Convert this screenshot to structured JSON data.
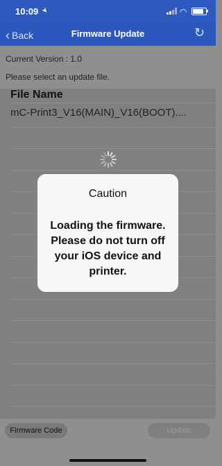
{
  "status_bar": {
    "time": "10:09"
  },
  "nav": {
    "back_label": "Back",
    "title": "Firmware Update"
  },
  "info": {
    "current_version": "Current Version : 1.0",
    "instruction": "Please select an update file."
  },
  "list": {
    "header": "File Name",
    "rows": [
      "mC-Print3_V16(MAIN)_V16(BOOT)...."
    ]
  },
  "dialog": {
    "title": "Caution",
    "message": "Loading the firmware. Please do not turn off your iOS device and printer."
  },
  "bottom": {
    "firmware_code_label": "Firmware Code",
    "update_label": "Update"
  },
  "colors": {
    "nav_blue": "#2a56bd",
    "overlay_gray": "#8f8f8f",
    "dialog_bg": "#f7f7f7"
  }
}
